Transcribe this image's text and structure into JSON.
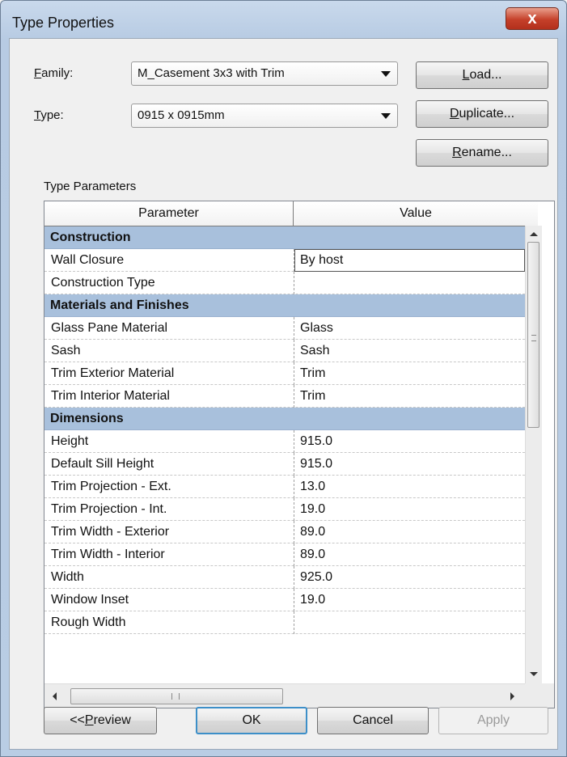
{
  "window": {
    "title": "Type Properties",
    "close_glyph": "x"
  },
  "family": {
    "label_prefix": "",
    "label_accel": "F",
    "label_rest": "amily:",
    "value": "M_Casement 3x3 with Trim"
  },
  "type": {
    "label_accel": "T",
    "label_rest": "ype:",
    "value": "0915 x 0915mm"
  },
  "buttons": {
    "load": {
      "accel": "L",
      "rest": "oad..."
    },
    "duplicate": {
      "accel": "D",
      "rest": "uplicate..."
    },
    "rename": {
      "accel": "R",
      "rest": "ename..."
    },
    "preview": {
      "prefix": "<< ",
      "accel": "P",
      "rest": "review"
    },
    "ok": "OK",
    "cancel": "Cancel",
    "apply": "Apply"
  },
  "section_label": "Type Parameters",
  "table": {
    "columns": [
      "Parameter",
      "Value"
    ],
    "rows": [
      {
        "kind": "group",
        "param": "Construction"
      },
      {
        "kind": "item",
        "param": "Wall Closure",
        "value": "By host",
        "editing": true
      },
      {
        "kind": "item",
        "param": "Construction Type",
        "value": ""
      },
      {
        "kind": "group",
        "param": "Materials and Finishes"
      },
      {
        "kind": "item",
        "param": "Glass Pane Material",
        "value": "Glass"
      },
      {
        "kind": "item",
        "param": "Sash",
        "value": "Sash"
      },
      {
        "kind": "item",
        "param": "Trim Exterior Material",
        "value": "Trim"
      },
      {
        "kind": "item",
        "param": "Trim Interior Material",
        "value": "Trim"
      },
      {
        "kind": "group",
        "param": "Dimensions"
      },
      {
        "kind": "item",
        "param": "Height",
        "value": "915.0"
      },
      {
        "kind": "item",
        "param": "Default Sill Height",
        "value": "915.0"
      },
      {
        "kind": "item",
        "param": "Trim Projection - Ext.",
        "value": "13.0"
      },
      {
        "kind": "item",
        "param": "Trim Projection - Int.",
        "value": "19.0"
      },
      {
        "kind": "item",
        "param": "Trim Width - Exterior",
        "value": "89.0"
      },
      {
        "kind": "item",
        "param": "Trim Width - Interior",
        "value": "89.0"
      },
      {
        "kind": "item",
        "param": "Width",
        "value": "925.0"
      },
      {
        "kind": "item",
        "param": "Window Inset",
        "value": "19.0"
      },
      {
        "kind": "item",
        "param": "Rough Width",
        "value": ""
      }
    ]
  },
  "colors": {
    "group_header": "#a8c0dc",
    "default_button_border": "#3d8fc8",
    "close_button": "#c5402a"
  }
}
